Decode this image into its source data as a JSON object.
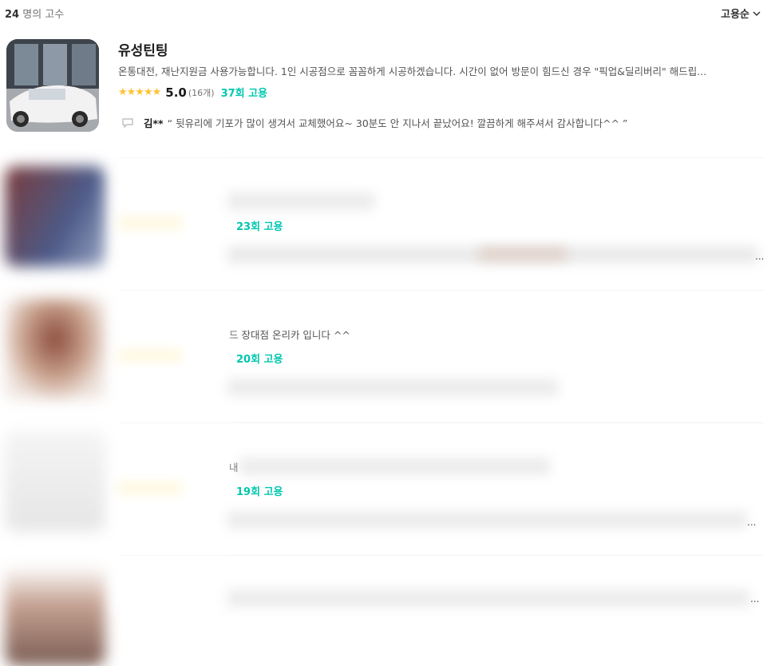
{
  "header": {
    "count_number": "24",
    "count_label": "명의 고수",
    "sort_label": "고용순"
  },
  "pros": [
    {
      "name": "유성틴팅",
      "description": "온통대전, 재난지원금 사용가능합니다. 1인 시공점으로 꼼꼼하게 시공하겠습니다. 시간이 없어 방문이 힘드신 경우 \"픽업&딜리버리\" 해드립...",
      "stars": "★★★★★",
      "rating": "5.0",
      "review_count": "(16개)",
      "hires": "37회 고용",
      "review_author": "김**",
      "review_text": "“ 뒷유리에 기포가 많이 생겨서 교체했어요~ 30분도 안 지나서 끝났어요! 깔끔하게 해주셔서 감사합니다^^ ”"
    },
    {
      "hires": "23회 고용"
    },
    {
      "description_fragment": "드 장대점 온리카 입니다 ^^",
      "hires": "20회 고용"
    },
    {
      "description_fragment": "내",
      "hires": "19회 고용"
    },
    {}
  ],
  "ellipsis": "...",
  "colors": {
    "accent": "#00c7ae",
    "star": "#ffc233"
  }
}
